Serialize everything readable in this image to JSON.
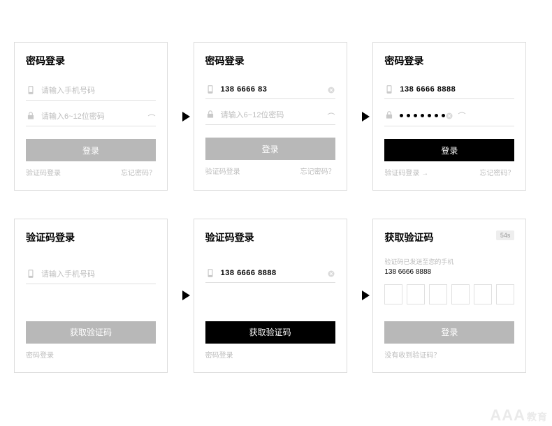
{
  "labels": {
    "password_login_title": "密码登录",
    "sms_login_title": "验证码登录",
    "get_code_title": "获取验证码",
    "phone_placeholder": "请输入手机号码",
    "password_placeholder": "请输入6~12位密码",
    "login_btn": "登录",
    "get_code_btn": "获取验证码",
    "sms_login_link": "验证码登录",
    "sms_login_link_arrow": "验证码登录 →",
    "forgot_link": "忘记密码？",
    "password_login_link": "密码登录",
    "not_received_link": "没有收到验证码？",
    "sent_hint": "验证码已发送至您的手机"
  },
  "values": {
    "phone_partial": "138 6666 83",
    "phone_full": "138 6666 8888",
    "phone_full_2": "138 6666 8888",
    "sent_phone": "138 6666 8888",
    "countdown": "54s"
  },
  "watermark": {
    "main": "AAA",
    "suffix": "教育"
  }
}
